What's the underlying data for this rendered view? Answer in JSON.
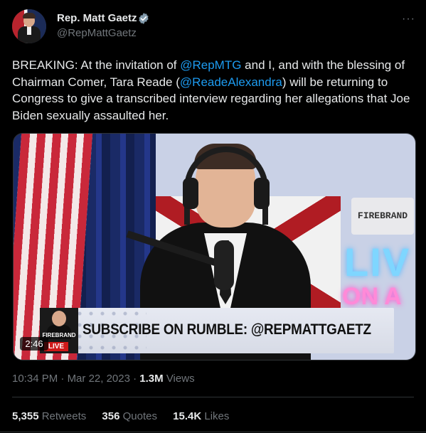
{
  "author": {
    "name": "Rep. Matt Gaetz",
    "handle": "@RepMattGaetz",
    "verified_color": "#829aab"
  },
  "tweet": {
    "text_parts": [
      {
        "t": "BREAKING: At the invitation of ",
        "link": false
      },
      {
        "t": "@RepMTG",
        "link": true
      },
      {
        "t": " and I, and with the blessing of Chairman Comer, Tara Reade (",
        "link": false
      },
      {
        "t": "@ReadeAlexandra",
        "link": true
      },
      {
        "t": ") will be returning to Congress to give a transcribed interview regarding her allegations that Joe Biden sexually assaulted her.",
        "link": false
      }
    ]
  },
  "media": {
    "banner_text": "SUBSCRIBE ON RUMBLE: @REPMATTGAETZ",
    "banner_brand": "FIREBRAND",
    "banner_live": "LIVE",
    "plate_text": "FIREBRAND",
    "neon_live": "LIV",
    "neon_on": "ON A",
    "duration": "2:46"
  },
  "meta": {
    "time": "10:34 PM",
    "date": "Mar 22, 2023",
    "views_count": "1.3M",
    "views_label": "Views"
  },
  "stats": {
    "retweets_count": "5,355",
    "retweets_label": "Retweets",
    "quotes_count": "356",
    "quotes_label": "Quotes",
    "likes_count": "15.4K",
    "likes_label": "Likes"
  },
  "colors": {
    "link": "#1d9bf0",
    "muted": "#71767b",
    "text": "#e7e9ea",
    "background": "#000000"
  }
}
